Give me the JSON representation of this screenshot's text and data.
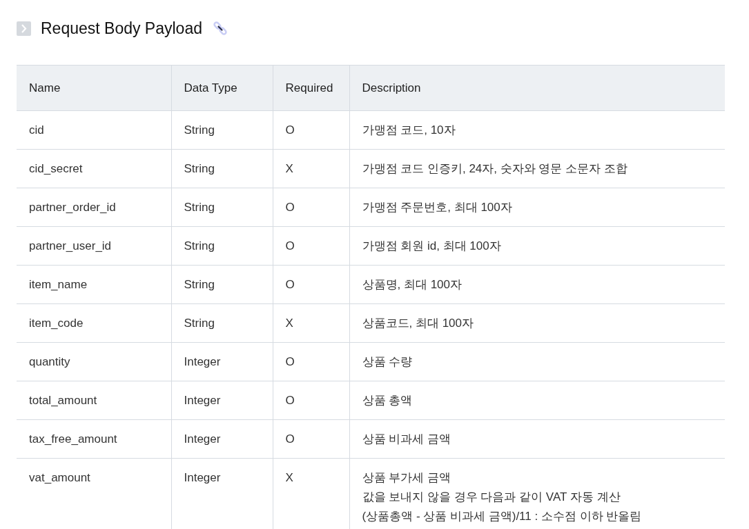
{
  "heading": {
    "title": "Request Body Payload"
  },
  "table": {
    "columns": [
      "Name",
      "Data Type",
      "Required",
      "Description"
    ],
    "rows": [
      {
        "name": "cid",
        "type": "String",
        "required": "O",
        "description": [
          "가맹점 코드, 10자"
        ]
      },
      {
        "name": "cid_secret",
        "type": "String",
        "required": "X",
        "description": [
          "가맹점 코드 인증키, 24자, 숫자와 영문 소문자 조합"
        ]
      },
      {
        "name": "partner_order_id",
        "type": "String",
        "required": "O",
        "description": [
          "가맹점 주문번호, 최대 100자"
        ]
      },
      {
        "name": "partner_user_id",
        "type": "String",
        "required": "O",
        "description": [
          "가맹점 회원 id, 최대 100자"
        ]
      },
      {
        "name": "item_name",
        "type": "String",
        "required": "O",
        "description": [
          "상품명, 최대 100자"
        ]
      },
      {
        "name": "item_code",
        "type": "String",
        "required": "X",
        "description": [
          "상품코드, 최대 100자"
        ]
      },
      {
        "name": "quantity",
        "type": "Integer",
        "required": "O",
        "description": [
          "상품 수량"
        ]
      },
      {
        "name": "total_amount",
        "type": "Integer",
        "required": "O",
        "description": [
          "상품 총액"
        ]
      },
      {
        "name": "tax_free_amount",
        "type": "Integer",
        "required": "O",
        "description": [
          "상품 비과세 금액"
        ]
      },
      {
        "name": "vat_amount",
        "type": "Integer",
        "required": "X",
        "description": [
          "상품 부가세 금액",
          "값을 보내지 않을 경우 다음과 같이 VAT 자동 계산",
          "(상품총액 - 상품 비과세 금액)/11 : 소수점 이하 반올림"
        ]
      }
    ]
  }
}
